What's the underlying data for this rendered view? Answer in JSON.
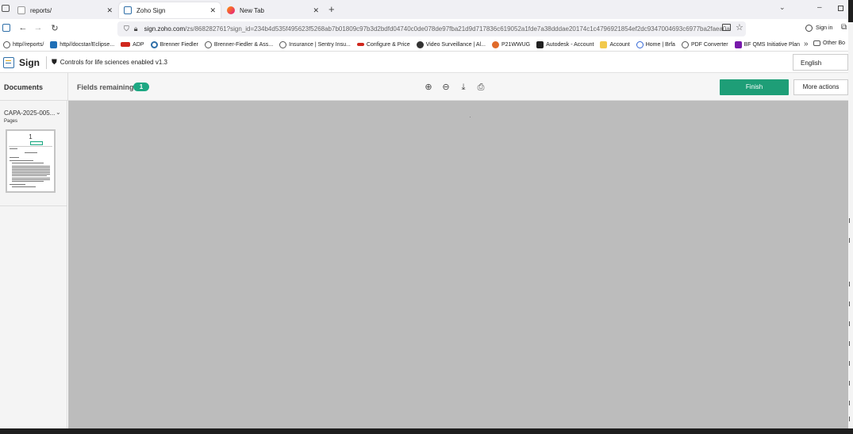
{
  "browser": {
    "tabs": [
      {
        "title": "reports/",
        "close": "✕"
      },
      {
        "title": "Zoho Sign",
        "close": "✕"
      },
      {
        "title": "New Tab",
        "close": "✕"
      }
    ],
    "new_tab": "+",
    "url_host": "sign.zoho.com",
    "url_path": "/zs/868282761?sign_id=234b4d535f495623f5268ab7b01809c97b3d2bdfd04740c0de078de97fba21d9d717836c619052a1fde7a38dddae20174c1c4796921854ef2dc9347004693c6977ba2faea0a",
    "sign_in": "Sign in",
    "bookmarks": [
      "http//reports/",
      "http//docstar/Eclipse...",
      "ADP",
      "Brenner Fiedler",
      "Brenner-Fiedler & Ass...",
      "Insurance | Sentry Insu...",
      "Configure & Price",
      "Video Surveillance | Al...",
      "P21WWUG",
      "Autodesk - Account",
      "Account",
      "Home | Brfa",
      "PDF Converter",
      "BF QMS Initiative Plan"
    ],
    "other_bookmarks": "Other Bo",
    "overflow": "»"
  },
  "app": {
    "name": "Sign",
    "controls_label": "Controls for life sciences enabled v1.3",
    "language": "English"
  },
  "toolbar": {
    "documents": "Documents",
    "fields_remaining_label": "Fields remaining:",
    "fields_remaining_count": "1",
    "finish": "Finish",
    "more_actions": "More actions"
  },
  "sidebar": {
    "document_name": "CAPA-2025-005...",
    "pages_label": "Pages",
    "page_number": "1"
  }
}
